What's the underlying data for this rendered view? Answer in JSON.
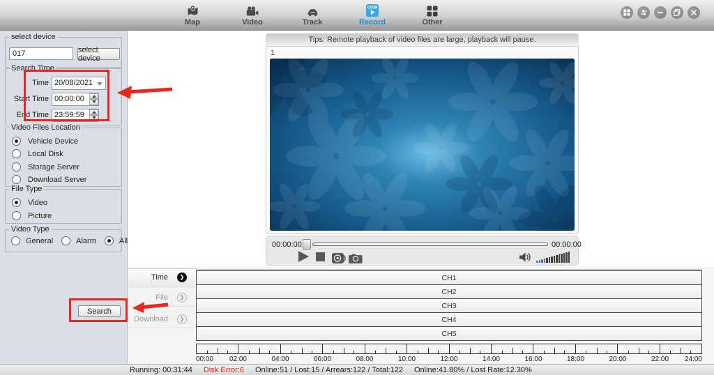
{
  "nav": {
    "items": [
      {
        "label": "Map"
      },
      {
        "label": "Video"
      },
      {
        "label": "Track"
      },
      {
        "label": "Record",
        "active": true
      },
      {
        "label": "Other"
      }
    ]
  },
  "sidebar": {
    "select_device": {
      "title": "select device",
      "device_value": "017",
      "button_label": "select device"
    },
    "search_time": {
      "title": "Search Time",
      "rows": [
        {
          "label": "Time",
          "value": "20/08/2021"
        },
        {
          "label": "Start Time",
          "value": "00:00:00"
        },
        {
          "label": "End Time",
          "value": "23:59:59"
        }
      ]
    },
    "video_files_location": {
      "title": "Video Files Location",
      "options": [
        {
          "label": "Vehicle Device",
          "selected": true
        },
        {
          "label": "Local Disk"
        },
        {
          "label": "Storage Server"
        },
        {
          "label": "Download Server"
        }
      ]
    },
    "file_type": {
      "title": "File Type",
      "options": [
        {
          "label": "Video",
          "selected": true
        },
        {
          "label": "Picture"
        }
      ]
    },
    "video_type": {
      "title": "Video Type",
      "options": [
        {
          "label": "General"
        },
        {
          "label": "Alarm"
        },
        {
          "label": "All",
          "selected": true
        }
      ]
    },
    "search_button": "Search"
  },
  "player": {
    "tips": "Tips: Remote playback of video files are large, playback will pause.",
    "window_label": "1",
    "elapsed": "00:00:00",
    "total": "00:00:00"
  },
  "timeline": {
    "tabs": [
      {
        "label": "Time",
        "active": true
      },
      {
        "label": "File"
      },
      {
        "label": "Download"
      }
    ],
    "channels": [
      "CH1",
      "CH2",
      "CH3",
      "CH4",
      "CH5"
    ],
    "tick_labels": [
      "00:00",
      "02:00",
      "04:00",
      "06:00",
      "08:00",
      "10:00",
      "12:00",
      "14:00",
      "16:00",
      "18:00",
      "20:00",
      "22:00",
      "24:00"
    ]
  },
  "statusbar": {
    "running": "Running: 00:31:44",
    "disk_error": "Disk Error:6",
    "counts": "Online:51 / Lost:15 / Arrears:122 / Total:122",
    "rates": "Online:41.80% / Lost Rate:12.30%"
  },
  "colors": {
    "accent_blue": "#1b8dcd",
    "record_icon_blue": "#35a8e0",
    "error_red": "#e02a20",
    "annotation_red": "#e8281e"
  }
}
